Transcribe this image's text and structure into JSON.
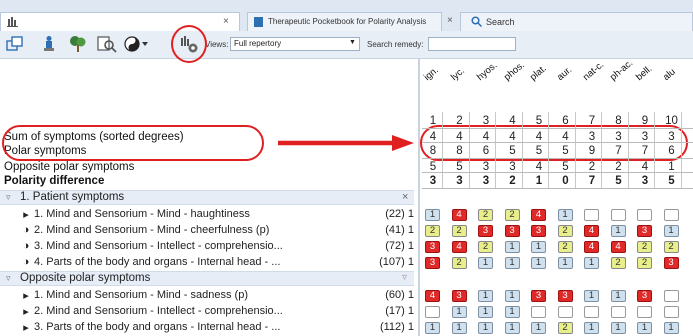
{
  "tabs": {
    "tab2_title": "Therapeutic Pocketbook for Polarity Analysis (authorized by Heiner Frei) (BÖNNI...",
    "search_label": "Search",
    "close": "×"
  },
  "toolbar": {
    "views_label": "Views:",
    "views_value": "Full repertory",
    "search_remedy_label": "Search remedy:",
    "search_remedy_value": ""
  },
  "left": {
    "sum_symptoms": "Sum of symptoms (sorted degrees)",
    "polar_symptoms": "Polar symptoms",
    "opposite_polar": "Opposite polar symptoms",
    "polarity_difference": "Polarity difference"
  },
  "groups": [
    {
      "label": "1. Patient symptoms",
      "toggle": "×",
      "rows": [
        {
          "pre": "▸",
          "text": "1. Mind and Sensorium - Mind - haughtiness",
          "count": "(22) 1"
        },
        {
          "pre": "◑",
          "text": "2. Mind and Sensorium - Mind - cheerfulness (p)",
          "count": "(41) 1"
        },
        {
          "pre": "◑",
          "text": "3. Mind and Sensorium - Intellect - comprehensio...",
          "count": "(72) 1"
        },
        {
          "pre": "◑",
          "text": "4. Parts of the body and organs - Internal head - ...",
          "count": "(107) 1"
        }
      ]
    },
    {
      "label": "Opposite polar symptoms",
      "toggle": "▿",
      "rows": [
        {
          "pre": "▸",
          "text": "1. Mind and Sensorium - Mind - sadness (p)",
          "count": "(60) 1"
        },
        {
          "pre": "▸",
          "text": "2. Mind and Sensorium - Intellect - comprehensio...",
          "count": "(17) 1"
        },
        {
          "pre": "▸",
          "text": "3. Parts of the body and organs - Internal head - ...",
          "count": "(112) 1"
        }
      ]
    }
  ],
  "remedies": [
    "ign.",
    "lyc.",
    "hyos.",
    "phos.",
    "plat.",
    "aur.",
    "nat-c.",
    "ph-ac.",
    "bell.",
    "alu"
  ],
  "col_numbers": [
    "1",
    "2",
    "3",
    "4",
    "5",
    "6",
    "7",
    "8",
    "9",
    "10"
  ],
  "sum_row": [
    "4",
    "4",
    "4",
    "4",
    "4",
    "4",
    "3",
    "3",
    "3",
    "3"
  ],
  "polar_row": [
    "8",
    "8",
    "6",
    "5",
    "5",
    "5",
    "9",
    "7",
    "7",
    "6"
  ],
  "opposite_row": [
    "5",
    "5",
    "3",
    "3",
    "4",
    "5",
    "2",
    "2",
    "4",
    "1"
  ],
  "difference_row": [
    "3",
    "3",
    "3",
    "2",
    "1",
    "0",
    "7",
    "5",
    "3",
    "5"
  ],
  "cells": [
    [
      [
        "g",
        "1"
      ],
      [
        "r",
        "4"
      ],
      [
        "y",
        "2"
      ],
      [
        "y",
        "2"
      ],
      [
        "r",
        "4"
      ],
      [
        "g",
        "1"
      ],
      [
        "e",
        ""
      ],
      [
        "e",
        ""
      ],
      [
        "e",
        ""
      ],
      [
        "e",
        ""
      ]
    ],
    [
      [
        "y",
        "2"
      ],
      [
        "y",
        "2"
      ],
      [
        "r",
        "3"
      ],
      [
        "r",
        "3"
      ],
      [
        "r",
        "3"
      ],
      [
        "y",
        "2"
      ],
      [
        "r",
        "4"
      ],
      [
        "g",
        "1"
      ],
      [
        "r",
        "3"
      ],
      [
        "g",
        "1"
      ]
    ],
    [
      [
        "r",
        "3"
      ],
      [
        "r",
        "4"
      ],
      [
        "y",
        "2"
      ],
      [
        "g",
        "1"
      ],
      [
        "g",
        "1"
      ],
      [
        "y",
        "2"
      ],
      [
        "r",
        "4"
      ],
      [
        "r",
        "4"
      ],
      [
        "y",
        "2"
      ],
      [
        "y",
        "2"
      ]
    ],
    [
      [
        "r",
        "3"
      ],
      [
        "y",
        "2"
      ],
      [
        "g",
        "1"
      ],
      [
        "g",
        "1"
      ],
      [
        "g",
        "1"
      ],
      [
        "g",
        "1"
      ],
      [
        "g",
        "1"
      ],
      [
        "y",
        "2"
      ],
      [
        "y",
        "2"
      ],
      [
        "r",
        "3"
      ]
    ],
    [
      [
        "r",
        "4"
      ],
      [
        "r",
        "3"
      ],
      [
        "g",
        "1"
      ],
      [
        "g",
        "1"
      ],
      [
        "r",
        "3"
      ],
      [
        "r",
        "3"
      ],
      [
        "g",
        "1"
      ],
      [
        "g",
        "1"
      ],
      [
        "r",
        "3"
      ],
      [
        "e",
        ""
      ]
    ],
    [
      [
        "e",
        ""
      ],
      [
        "g",
        "1"
      ],
      [
        "g",
        "1"
      ],
      [
        "g",
        "1"
      ],
      [
        "e",
        ""
      ],
      [
        "e",
        ""
      ],
      [
        "e",
        ""
      ],
      [
        "e",
        ""
      ],
      [
        "e",
        ""
      ],
      [
        "e",
        ""
      ]
    ],
    [
      [
        "g",
        "1"
      ],
      [
        "g",
        "1"
      ],
      [
        "g",
        "1"
      ],
      [
        "g",
        "1"
      ],
      [
        "g",
        "1"
      ],
      [
        "y",
        "2"
      ],
      [
        "g",
        "1"
      ],
      [
        "g",
        "1"
      ],
      [
        "g",
        "1"
      ],
      [
        "g",
        "1"
      ]
    ]
  ],
  "annotations": {
    "color": "#e02020"
  }
}
